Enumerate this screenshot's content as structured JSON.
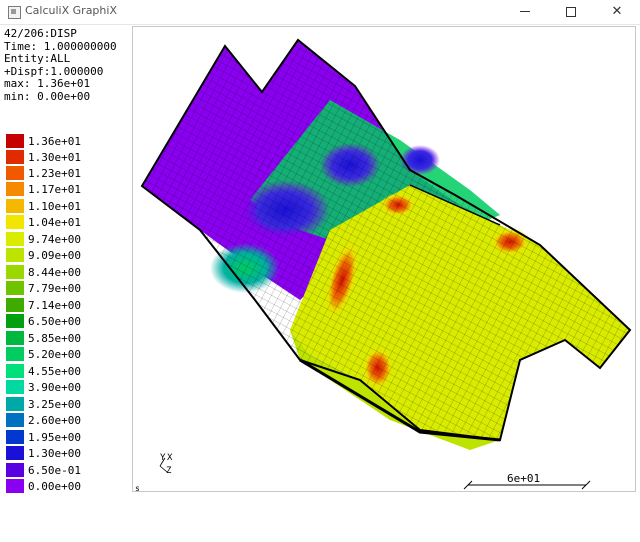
{
  "window": {
    "title": "CalculiX GraphiX"
  },
  "window_buttons": {
    "minimize": "",
    "maximize": "",
    "close": "✕"
  },
  "info": {
    "line1": "42/206:DISP",
    "line2": "Time: 1.000000000",
    "line3": "Entity:ALL",
    "line4": "+Dispf:1.000000",
    "line5": "max: 1.36e+01",
    "line6": "min: 0.00e+00"
  },
  "legend": [
    {
      "label": "1.36e+01",
      "color": "#c40000"
    },
    {
      "label": "1.30e+01",
      "color": "#e02a00"
    },
    {
      "label": "1.23e+01",
      "color": "#ef5a00"
    },
    {
      "label": "1.17e+01",
      "color": "#f58a00"
    },
    {
      "label": "1.10e+01",
      "color": "#f5b800"
    },
    {
      "label": "1.04e+01",
      "color": "#f2e600"
    },
    {
      "label": "9.74e+00",
      "color": "#d9ec00"
    },
    {
      "label": "9.09e+00",
      "color": "#bde300"
    },
    {
      "label": "8.44e+00",
      "color": "#9ad800"
    },
    {
      "label": "7.79e+00",
      "color": "#6fc400"
    },
    {
      "label": "7.14e+00",
      "color": "#3faa00"
    },
    {
      "label": "6.50e+00",
      "color": "#00a010"
    },
    {
      "label": "5.85e+00",
      "color": "#00b840"
    },
    {
      "label": "5.20e+00",
      "color": "#00cc60"
    },
    {
      "label": "4.55e+00",
      "color": "#00e07a"
    },
    {
      "label": "3.90e+00",
      "color": "#00d9a0"
    },
    {
      "label": "3.25e+00",
      "color": "#00a8a8"
    },
    {
      "label": "2.60e+00",
      "color": "#0070c0"
    },
    {
      "label": "1.95e+00",
      "color": "#0038d0"
    },
    {
      "label": "1.30e+00",
      "color": "#1a10d8"
    },
    {
      "label": "6.50e-01",
      "color": "#5a00e0"
    },
    {
      "label": "0.00e+00",
      "color": "#8a00f0"
    }
  ],
  "scale_bar": {
    "label": "6e+01"
  },
  "axes": {
    "y": "Y",
    "x": "X",
    "z": "Z"
  },
  "corner_label": "s"
}
